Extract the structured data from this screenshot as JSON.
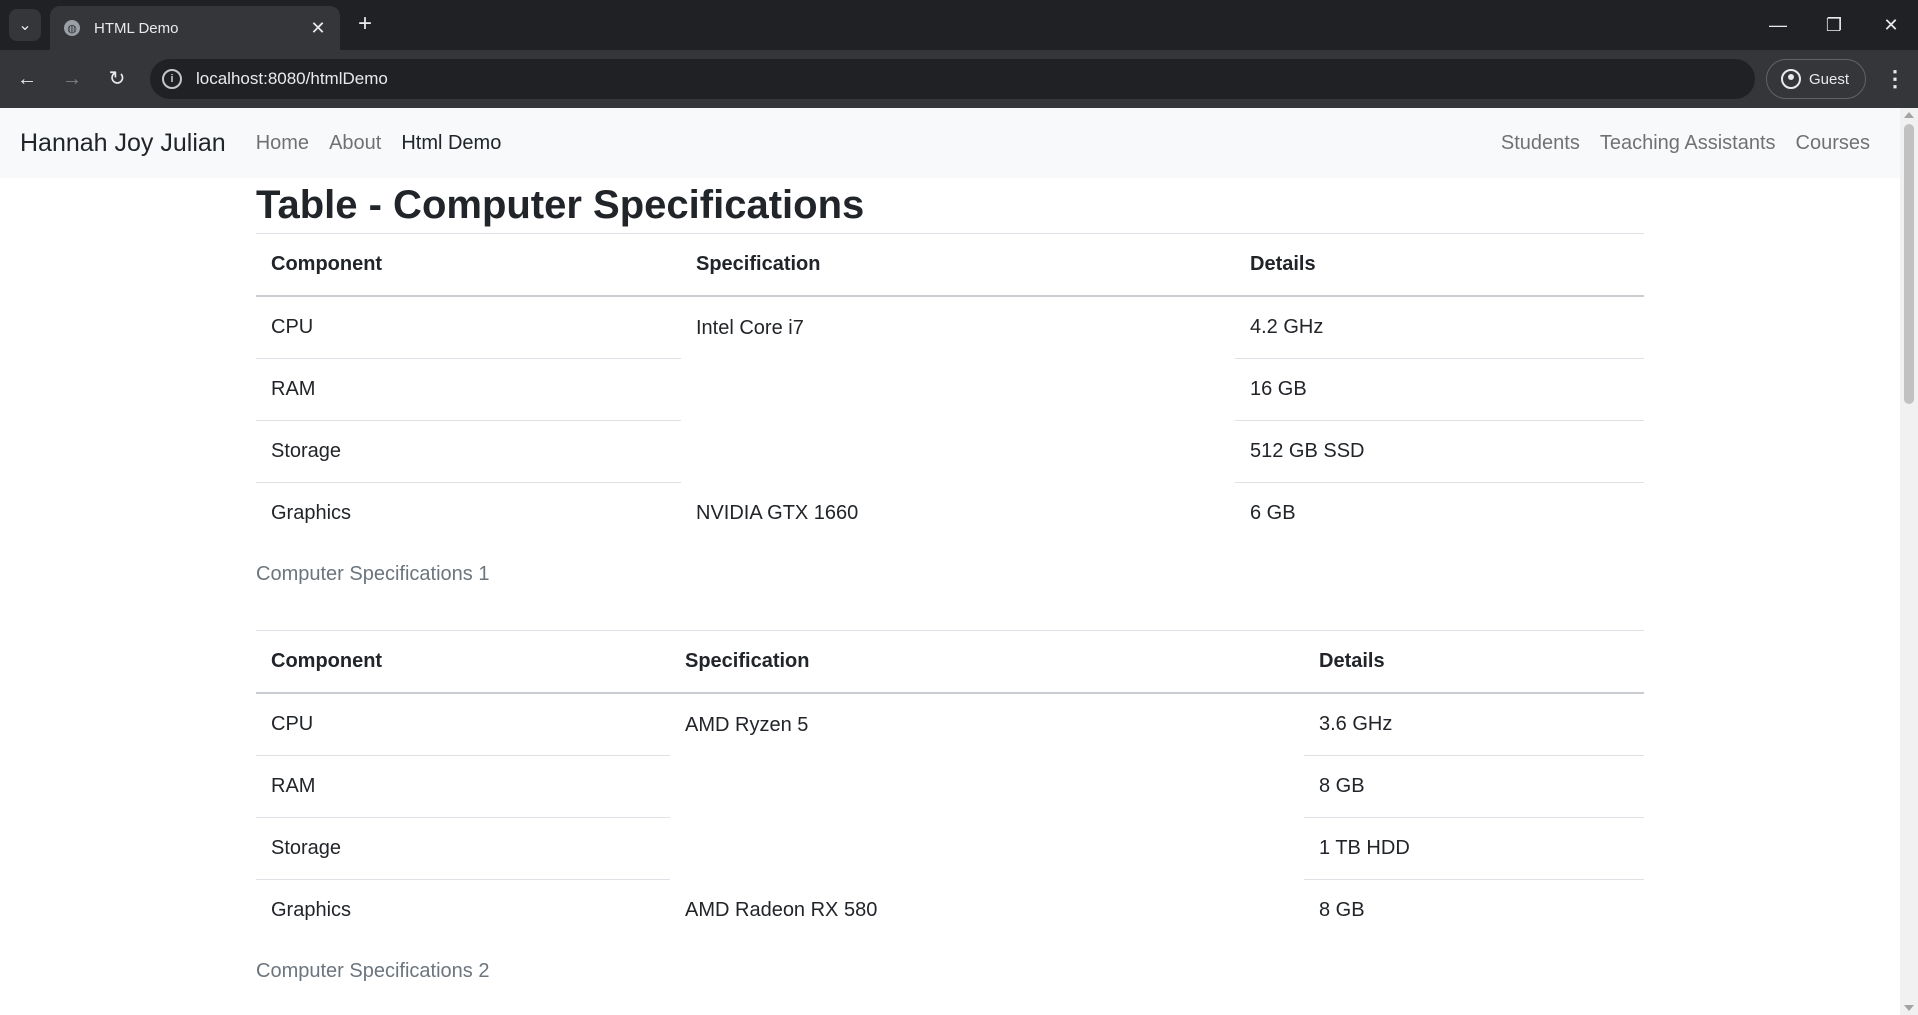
{
  "browser": {
    "tab_title": "HTML Demo",
    "url": "localhost:8080/htmlDemo",
    "profile_label": "Guest"
  },
  "navbar": {
    "brand": "Hannah Joy Julian",
    "left_links": [
      "Home",
      "About",
      "Html Demo"
    ],
    "right_links": [
      "Students",
      "Teaching Assistants",
      "Courses"
    ]
  },
  "page": {
    "title": "Table - Computer Specifications"
  },
  "tables": [
    {
      "headers": [
        "Component",
        "Specification",
        "Details"
      ],
      "components": [
        "CPU",
        "RAM",
        "Storage",
        "Graphics"
      ],
      "spec_group": "Intel Core i7",
      "spec_graphics": "NVIDIA GTX 1660",
      "details": [
        "4.2 GHz",
        "16 GB",
        "512 GB SSD",
        "6 GB"
      ],
      "caption": "Computer Specifications 1"
    },
    {
      "headers": [
        "Component",
        "Specification",
        "Details"
      ],
      "components": [
        "CPU",
        "RAM",
        "Storage",
        "Graphics"
      ],
      "spec_group": "AMD Ryzen 5",
      "spec_graphics": "AMD Radeon RX 580",
      "details": [
        "3.6 GHz",
        "8 GB",
        "1 TB HDD",
        "8 GB"
      ],
      "caption": "Computer Specifications 2"
    }
  ]
}
